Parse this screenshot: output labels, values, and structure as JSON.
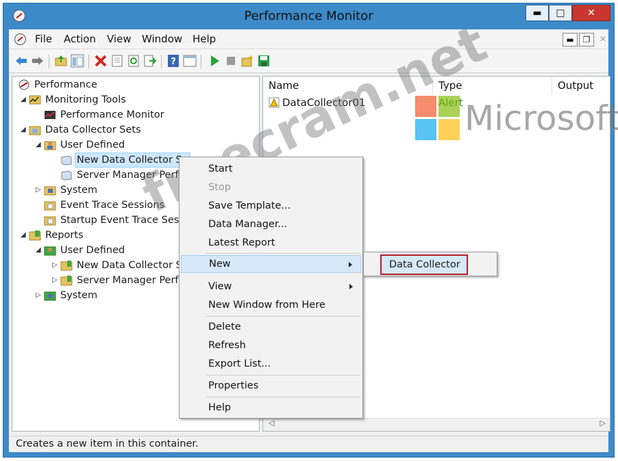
{
  "window": {
    "title": "Performance Monitor",
    "controls": {
      "minimize": "▬",
      "maximize": "□",
      "close": "✕"
    }
  },
  "menu_bar": {
    "items": [
      "File",
      "Action",
      "View",
      "Window",
      "Help"
    ],
    "mdi_controls": {
      "minimize": "▬",
      "restore": "❐",
      "close": "✕"
    }
  },
  "toolbar": {
    "icons": [
      "back-icon",
      "forward-icon",
      "up-folder-icon",
      "show-hide-tree-icon",
      "delete-icon",
      "properties-icon",
      "refresh-icon",
      "export-icon",
      "help-icon",
      "show-pane-icon",
      "start-icon",
      "stop-icon",
      "new-icon",
      "save-icon"
    ]
  },
  "tree": {
    "items": [
      {
        "label": "Performance"
      },
      {
        "label": "Monitoring Tools"
      },
      {
        "label": "Performance Monitor"
      },
      {
        "label": "Data Collector Sets"
      },
      {
        "label": "User Defined"
      },
      {
        "label": "New Data Collector Se"
      },
      {
        "label": "Server Manager Perfor"
      },
      {
        "label": "System"
      },
      {
        "label": "Event Trace Sessions"
      },
      {
        "label": "Startup Event Trace Sessio"
      },
      {
        "label": "Reports"
      },
      {
        "label": "User Defined"
      },
      {
        "label": "New Data Collector Se"
      },
      {
        "label": "Server Manager Perfor"
      },
      {
        "label": "System"
      }
    ]
  },
  "list": {
    "columns": [
      "Name",
      "Type",
      "Output"
    ],
    "rows": [
      {
        "name": "DataCollector01",
        "type": "Alert",
        "output": ""
      }
    ]
  },
  "context_menu": {
    "items": [
      "Start",
      "Stop",
      "Save Template...",
      "Data Manager...",
      "Latest Report",
      "New",
      "View",
      "New Window from Here",
      "Delete",
      "Refresh",
      "Export List...",
      "Properties",
      "Help"
    ]
  },
  "submenu": {
    "items": [
      "Data Collector"
    ]
  },
  "status_bar": {
    "text": "Creates a new item in this container."
  },
  "watermark": {
    "freecram": "freecram.net",
    "microsoft": "Microsoft"
  },
  "colors": {
    "title_bar": "#3d8ac9",
    "close_button": "#c7372f",
    "selection": "#cde8ff",
    "menu_highlight": "#d7e8f8",
    "submenu_outline": "#b21e2b",
    "alert_type": "#2d8b1e"
  }
}
